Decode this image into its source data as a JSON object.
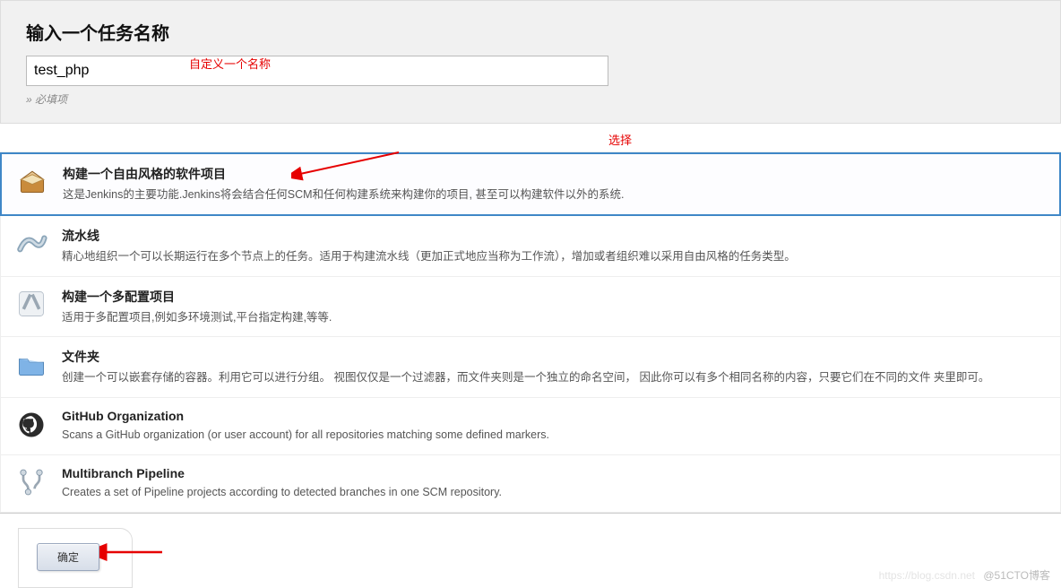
{
  "header": {
    "title": "输入一个任务名称",
    "input_value": "test_php",
    "required_note": "» 必填项"
  },
  "annotations": {
    "input_hint": "自定义一个名称",
    "select_hint": "选择"
  },
  "options": [
    {
      "key": "freestyle",
      "title": "构建一个自由风格的软件项目",
      "desc": "这是Jenkins的主要功能.Jenkins将会结合任何SCM和任何构建系统来构建你的项目, 甚至可以构建软件以外的系统.",
      "selected": true
    },
    {
      "key": "pipeline",
      "title": "流水线",
      "desc": "精心地组织一个可以长期运行在多个节点上的任务。适用于构建流水线（更加正式地应当称为工作流），增加或者组织难以采用自由风格的任务类型。",
      "selected": false
    },
    {
      "key": "multiconfig",
      "title": "构建一个多配置项目",
      "desc": "适用于多配置项目,例如多环境测试,平台指定构建,等等.",
      "selected": false
    },
    {
      "key": "folder",
      "title": "文件夹",
      "desc": "创建一个可以嵌套存储的容器。利用它可以进行分组。 视图仅仅是一个过滤器，而文件夹则是一个独立的命名空间， 因此你可以有多个相同名称的内容，只要它们在不同的文件 夹里即可。",
      "selected": false
    },
    {
      "key": "github-org",
      "title": "GitHub Organization",
      "desc": "Scans a GitHub organization (or user account) for all repositories matching some defined markers.",
      "selected": false
    },
    {
      "key": "multibranch",
      "title": "Multibranch Pipeline",
      "desc": "Creates a set of Pipeline projects according to detected branches in one SCM repository.",
      "selected": false
    }
  ],
  "footer": {
    "ok_label": "确定"
  },
  "watermark": {
    "faint": "https://blog.csdn.net",
    "text": "@51CTO博客"
  }
}
